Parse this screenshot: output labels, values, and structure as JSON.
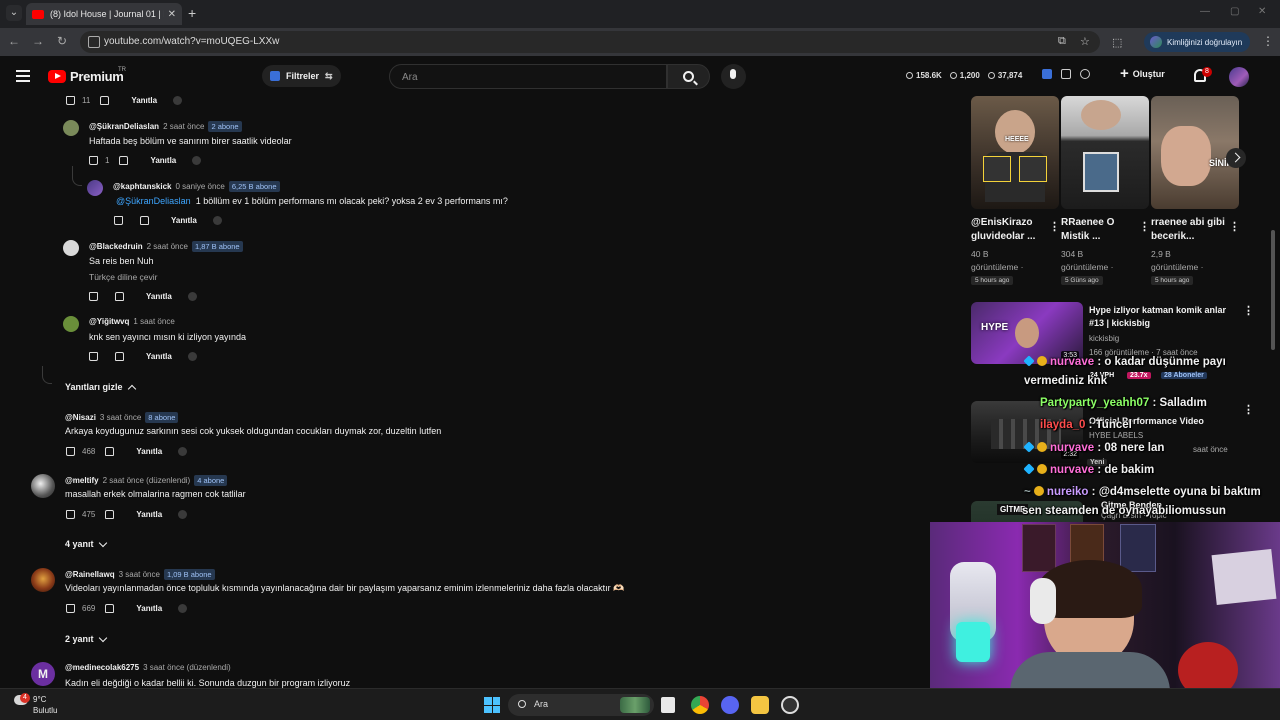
{
  "browser": {
    "tab_title": "(8) Idol House | Journal 01 | Evo",
    "url": "youtube.com/watch?v=moUQEG-LXXw",
    "profile_label": "Kimliğinizi doğrulayın"
  },
  "header": {
    "logo_text": "Premium",
    "region": "TR",
    "filter_label": "Filtreler",
    "search_placeholder": "Ara",
    "stats": [
      "158.6K",
      "1,200",
      "37,874"
    ],
    "create_label": "Oluştur",
    "notifications": "8"
  },
  "comments": {
    "top_actions": {
      "likes": "11",
      "reply": "Yanıtla"
    },
    "replies": [
      {
        "author": "@ŞükranDeliaslan",
        "time": "2 saat önce",
        "badge": "2 abone",
        "text": "Haftada beş bölüm ve sanırım birer saatlik videolar",
        "likes": "1",
        "reply": "Yanıtla"
      },
      {
        "author": "@kaphtanskick",
        "time": "0 saniye önce",
        "badge": "6,25 B abone",
        "mention": "@ŞükranDeliaslan",
        "text": "1 böllüm ev 1 bölüm performans mı olacak peki? yoksa 2 ev 3 performans mı?",
        "likes": "",
        "reply": "Yanıtla"
      },
      {
        "author": "@Blackedruin",
        "time": "2 saat önce",
        "badge": "1,87 B abone",
        "text": "Sa reis ben Nuh",
        "translate": "Türkçe diline çevir",
        "likes": "",
        "reply": "Yanıtla"
      },
      {
        "author": "@Yiğitwvq",
        "time": "1 saat önce",
        "badge": "",
        "text": "knk sen yayıncı mısın ki izliyon yayında",
        "likes": "",
        "reply": "Yanıtla"
      }
    ],
    "hide_replies": "Yanıtları gizle",
    "threads": [
      {
        "author": "@Nisazi",
        "time": "3 saat önce",
        "badge": "8 abone",
        "text": "Arkaya koydugunuz sarkının sesi cok yuksek oldugundan cocukları duymak zor, duzeltin lutfen",
        "likes": "468",
        "reply": "Yanıtla"
      },
      {
        "author": "@meltify",
        "time": "2 saat önce (düzenlendi)",
        "badge": "4 abone",
        "text": "masallah erkek olmalarina ragmen cok tatlilar",
        "likes": "475",
        "reply": "Yanıtla",
        "replies_toggle": "4 yanıt"
      },
      {
        "author": "@Rainellawq",
        "time": "3 saat önce",
        "badge": "1,09 B abone",
        "text": "Videoları yayınlanmadan önce topluluk kısmında yayınlanacağına dair bir paylaşım yaparsanız eminim izlenmeleriniz daha fazla olacaktır 🫶🏻",
        "likes": "669",
        "reply": "Yanıtla",
        "replies_toggle": "2 yanıt"
      },
      {
        "author": "@medinecolak6275",
        "time": "3 saat önce (düzenlendi)",
        "badge": "",
        "avatar_letter": "M",
        "text": "Kadın eli değdiği o kadar bellii ki. Sonunda duzgun bir program izliyoruz"
      }
    ]
  },
  "shorts": [
    {
      "title": "@EnisKirazo gluvideolar ...",
      "views": "40 B",
      "views_label": "görüntüleme ·",
      "tag": "5 hours ago",
      "thumb_text": "HEEEE"
    },
    {
      "title": "RRaenee O Mistik ...",
      "views": "304 B",
      "views_label": "görüntüleme ·",
      "tag": "5 Güns ago",
      "thumb_text": ""
    },
    {
      "title": "rraenee abi gibi becerik...",
      "views": "2,9 B",
      "views_label": "görüntüleme ·",
      "tag": "5 hours ago",
      "thumb_text": "SİNİR"
    }
  ],
  "recommended": [
    {
      "title": "Hype izliyor katman komik anlar #13 | kickisbig",
      "channel": "kickisbig",
      "meta": "166 görüntüleme · 7 saat önce",
      "duration": "3:53",
      "thumb_text": "HYPE",
      "vph": "24 VPH",
      "ratio": "23.7x",
      "subs": "28 Aboneler"
    },
    {
      "title": "Official Performance Video",
      "channel": "HYBE LABELS",
      "meta": "saat önce",
      "duration": "2:32",
      "thumb_text": "",
      "label_top": "Yeni"
    },
    {
      "title": "Gitme Benden",
      "channel": "Çağrı Ersin · Topic",
      "meta": "",
      "duration": "",
      "thumb_text": "GİTME"
    }
  ],
  "chat": [
    {
      "user": "nurvave",
      "msg": ": o kadar düşünme payı",
      "user_color": "#ff6fd8"
    },
    {
      "user": "",
      "msg": "vermediniz knk",
      "user_color": "#ffffff"
    },
    {
      "user": "Partyparty_yeahh07",
      "msg": ": Salladım",
      "user_color": "#8cff66"
    },
    {
      "user": "ilayda_0",
      "msg": ": Tuncel",
      "user_color": "#ff4d4d"
    },
    {
      "user": "nurvave",
      "msg": ": 08 nere lan",
      "user_color": "#ff6fd8"
    },
    {
      "user": "nurvave",
      "msg": ": de bakim",
      "user_color": "#ff6fd8"
    },
    {
      "user": "nureiko",
      "msg": ": @d4mselette oyuna bi baktım",
      "user_color": "#c99cff",
      "mention": "@d4mselette"
    },
    {
      "user": "",
      "msg": "sen steamden de oynayabiliomussun",
      "user_color": "#ffffff"
    }
  ],
  "taskbar": {
    "temp": "9°C",
    "weather": "Bulutlu",
    "weather_badge": "4",
    "search_label": "Ara"
  },
  "colors": {
    "background": "#0f0f0f",
    "accent_red": "#ff0000",
    "link_blue": "#3ea6ff"
  }
}
